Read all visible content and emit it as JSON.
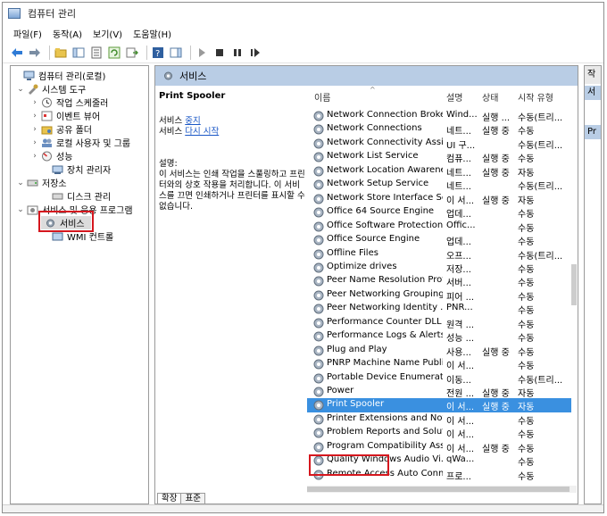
{
  "window": {
    "title": "컴퓨터 관리"
  },
  "menu": [
    "파일(F)",
    "동작(A)",
    "보기(V)",
    "도움말(H)"
  ],
  "tree": {
    "root": "컴퓨터 관리(로컬)",
    "system_tools": "시스템 도구",
    "task_scheduler": "작업 스케줄러",
    "event_viewer": "이벤트 뷰어",
    "shared_folders": "공유 폴더",
    "local_users": "로컬 사용자 및 그룹",
    "performance": "성능",
    "device_manager": "장치 관리자",
    "storage": "저장소",
    "disk_management": "디스크 관리",
    "services_apps": "서비스 및 응용 프로그램",
    "services": "서비스",
    "wmi_control": "WMI 컨트롤"
  },
  "center": {
    "header": "서비스",
    "selected_service": "Print Spooler",
    "action_stop_prefix": "서비스 ",
    "action_stop_link": "중지",
    "action_restart_prefix": "서비스 ",
    "action_restart_link": "다시 시작",
    "desc_label": "설명:",
    "desc_text": "이 서비스는 인쇄 작업을 스풀링하고 프린터와의 상호 작용을 처리합니다. 이 서비스를 끄면 인쇄하거나 프린터를 표시할 수 없습니다."
  },
  "columns": {
    "name": "이름",
    "desc": "설명",
    "status": "상태",
    "startup": "시작 유형"
  },
  "services": [
    {
      "name": "Network Connection Broker",
      "desc": "Wind...",
      "status": "실행 ...",
      "startup": "수동(트리..."
    },
    {
      "name": "Network Connections",
      "desc": "네트...",
      "status": "실행 중",
      "startup": "수동"
    },
    {
      "name": "Network Connectivity Assis...",
      "desc": "UI 구...",
      "status": "",
      "startup": "수동(트리..."
    },
    {
      "name": "Network List Service",
      "desc": "컴퓨...",
      "status": "실행 중",
      "startup": "수동"
    },
    {
      "name": "Network Location Awareness",
      "desc": "네트...",
      "status": "실행 중",
      "startup": "자동"
    },
    {
      "name": "Network Setup Service",
      "desc": "네트...",
      "status": "",
      "startup": "수동(트리..."
    },
    {
      "name": "Network Store Interface Se...",
      "desc": "이 서...",
      "status": "실행 중",
      "startup": "자동"
    },
    {
      "name": "Office 64 Source Engine",
      "desc": "업데...",
      "status": "",
      "startup": "수동"
    },
    {
      "name": "Office Software Protection ...",
      "desc": "Offic...",
      "status": "",
      "startup": "수동"
    },
    {
      "name": "Office Source Engine",
      "desc": "업데...",
      "status": "",
      "startup": "수동"
    },
    {
      "name": "Offline Files",
      "desc": "오프...",
      "status": "",
      "startup": "수동(트리..."
    },
    {
      "name": "Optimize drives",
      "desc": "저장...",
      "status": "",
      "startup": "수동"
    },
    {
      "name": "Peer Name Resolution Prot...",
      "desc": "서버...",
      "status": "",
      "startup": "수동"
    },
    {
      "name": "Peer Networking Grouping",
      "desc": "피어 ...",
      "status": "",
      "startup": "수동"
    },
    {
      "name": "Peer Networking Identity ...",
      "desc": "PNR...",
      "status": "",
      "startup": "수동"
    },
    {
      "name": "Performance Counter DLL ...",
      "desc": "원격 ...",
      "status": "",
      "startup": "수동"
    },
    {
      "name": "Performance Logs & Alerts",
      "desc": "성능 ...",
      "status": "",
      "startup": "수동"
    },
    {
      "name": "Plug and Play",
      "desc": "사용...",
      "status": "실행 중",
      "startup": "수동"
    },
    {
      "name": "PNRP Machine Name Publi...",
      "desc": "이 서...",
      "status": "",
      "startup": "수동"
    },
    {
      "name": "Portable Device Enumerato...",
      "desc": "이동...",
      "status": "",
      "startup": "수동(트리..."
    },
    {
      "name": "Power",
      "desc": "전원 ...",
      "status": "실행 중",
      "startup": "자동"
    },
    {
      "name": "Print Spooler",
      "desc": "이 서...",
      "status": "실행 중",
      "startup": "자동"
    },
    {
      "name": "Printer Extensions and Noti...",
      "desc": "이 서...",
      "status": "",
      "startup": "수동"
    },
    {
      "name": "Problem Reports and Solut...",
      "desc": "이 서...",
      "status": "",
      "startup": "수동"
    },
    {
      "name": "Program Compatibility Assi...",
      "desc": "이 서...",
      "status": "실행 중",
      "startup": "수동"
    },
    {
      "name": "Quality Windows Audio Vi...",
      "desc": "qWa...",
      "status": "",
      "startup": "수동"
    },
    {
      "name": "Remote Access Auto Conn...",
      "desc": "프로...",
      "status": "",
      "startup": "수동"
    }
  ],
  "tabs": {
    "extended": "확장",
    "standard": "표준"
  },
  "right_pane": {
    "header": "작",
    "band1": "서",
    "band2": "Pr"
  },
  "colors": {
    "highlight": "#d5171e",
    "selection": "#3a90e0",
    "header_band": "#b9cde5"
  }
}
